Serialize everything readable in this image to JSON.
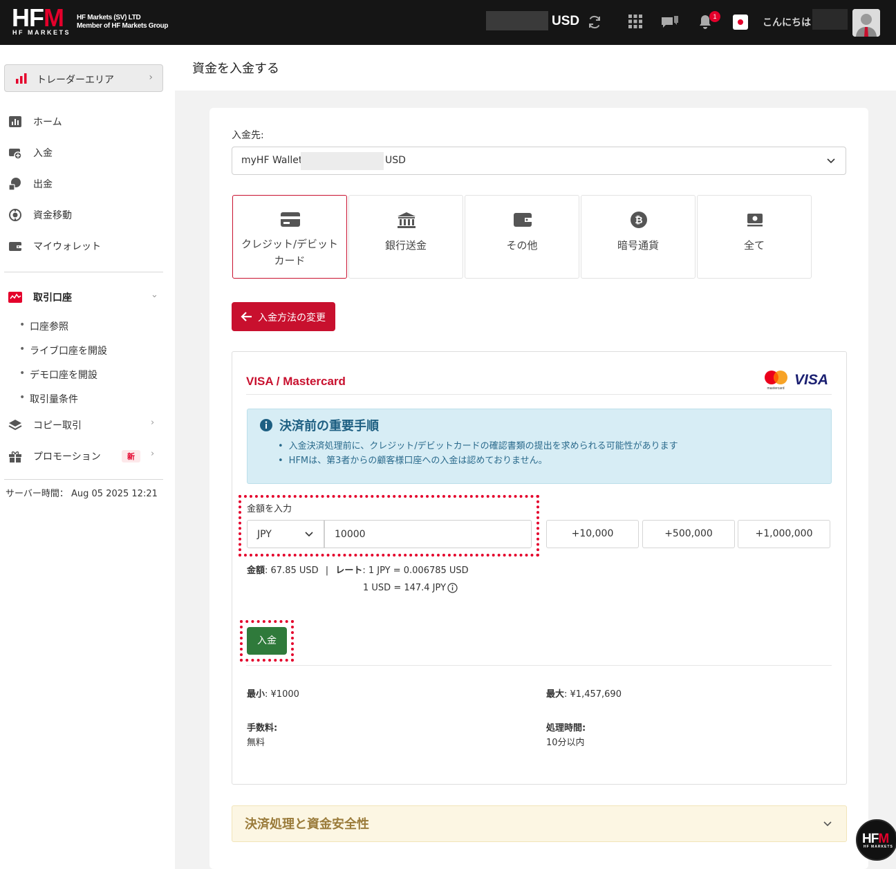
{
  "header": {
    "logo_text_a": "HF",
    "logo_text_b": "M",
    "logo_sub": "HF MARKETS",
    "company_line1": "HF Markets (SV) LTD",
    "company_line2": "Member of HF Markets Group",
    "balance_currency": "USD",
    "notification_count": "1",
    "greeting": "こんにちは"
  },
  "sidebar": {
    "trader_area": "トレーダーエリア",
    "nav": {
      "home": "ホーム",
      "deposit": "入金",
      "withdraw": "出金",
      "transfer": "資金移動",
      "wallet": "マイウォレット",
      "trading_accounts": "取引口座",
      "copy_trading": "コピー取引",
      "promotions": "プロモーション"
    },
    "trading_sub": [
      "口座参照",
      "ライブ口座を開設",
      "デモ口座を開設",
      "取引量条件"
    ],
    "new_badge": "新",
    "server_time": "サーバー時間： Aug 05 2025 12:21"
  },
  "page": {
    "title": "資金を入金する",
    "deposit_to_label": "入金先:",
    "wallet_prefix": "myHF Wallet:",
    "wallet_currency": "USD",
    "methods": [
      {
        "label": "クレジット/デビットカード",
        "icon": "credit-card-icon"
      },
      {
        "label": "銀行送金",
        "icon": "bank-icon"
      },
      {
        "label": "その他",
        "icon": "wallet-icon"
      },
      {
        "label": "暗号通貨",
        "icon": "bitcoin-icon"
      },
      {
        "label": "全て",
        "icon": "cash-icon"
      }
    ],
    "change_method": "入金方法の変更"
  },
  "payment": {
    "title": "VISA / Mastercard",
    "mastercard_text": "mastercard",
    "visa_text": "VISA",
    "info_title": "決済前の重要手順",
    "info_items": [
      "入金決済処理前に、クレジット/デビットカードの確認書類の提出を求められる可能性があります",
      "HFMは、第3者からの顧客様口座への入金は認めておりません。"
    ],
    "amount_label": "金額を入力",
    "currency": "JPY",
    "amount_value": "10000",
    "quick": [
      "+10,000",
      "+500,000",
      "+1,000,000"
    ],
    "calc_amount_label": "金額",
    "calc_amount": ": 67.85 USD",
    "calc_sep": "|",
    "calc_rate_label": "レート",
    "calc_rate": ": 1 JPY = 0.006785 USD",
    "calc_rate2": "1 USD = 147.4 JPY",
    "deposit_button": "入金",
    "min_label": "最小",
    "min_value": ": ¥1000",
    "max_label": "最大",
    "max_value": ": ¥1,457,690",
    "fee_label": "手数料:",
    "fee_value": "無料",
    "time_label": "処理時間:",
    "time_value": "10分以内"
  },
  "accordion": {
    "title": "決済処理と資金安全性"
  },
  "colors": {
    "brand_red": "#c8102e",
    "deposit_green": "#2f7a3b",
    "header_bg": "#151515"
  }
}
